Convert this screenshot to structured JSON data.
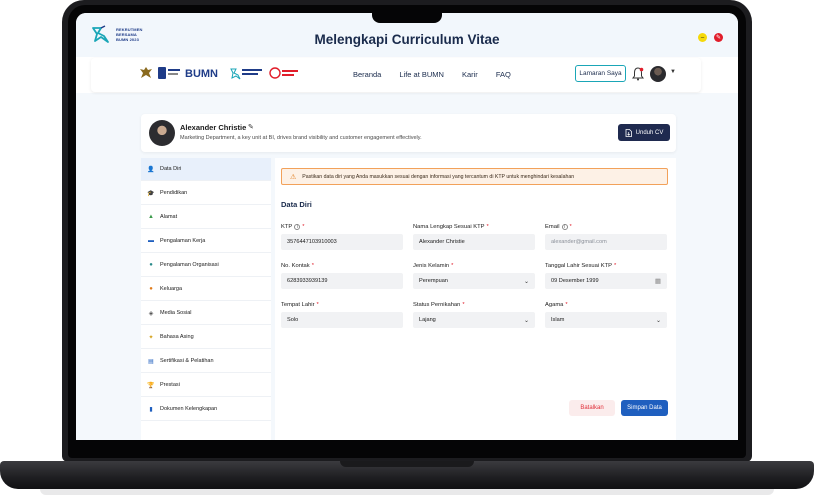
{
  "header": {
    "brand_text": [
      "REKRUTMEN",
      "BERSAMA",
      "BUMN 2023"
    ],
    "page_title": "Melengkapi Curriculum Vitae"
  },
  "navbar": {
    "links": [
      "Beranda",
      "Life at BUMN",
      "Karir",
      "FAQ"
    ],
    "lamaran_button": "Lamaran Saya"
  },
  "profile": {
    "name": "Alexander Christie",
    "description": "Marketing Department, a key unit at BI, drives brand visibility and customer engagement effectively.",
    "download_button": "Unduh CV"
  },
  "sidebar": {
    "items": [
      {
        "label": "Data Diri",
        "icon": "person-icon",
        "active": true
      },
      {
        "label": "Pendidikan",
        "icon": "graduation-cap-icon"
      },
      {
        "label": "Alamat",
        "icon": "map-icon"
      },
      {
        "label": "Pengalaman Kerja",
        "icon": "briefcase-icon"
      },
      {
        "label": "Pengalaman Organisasi",
        "icon": "organization-icon"
      },
      {
        "label": "Keluarga",
        "icon": "family-icon"
      },
      {
        "label": "Media Sosial",
        "icon": "social-icon"
      },
      {
        "label": "Bahasa Asing",
        "icon": "language-icon"
      },
      {
        "label": "Sertifikasi & Pelatihan",
        "icon": "certificate-icon"
      },
      {
        "label": "Prestasi",
        "icon": "trophy-icon"
      },
      {
        "label": "Dokumen Kelengkapan",
        "icon": "document-icon"
      }
    ]
  },
  "form": {
    "alert": "Pastikan data diri yang Anda masukkan sesuai dengan informasi yang tercantum di KTP untuk menghindari kesalahan",
    "section_title": "Data Diri",
    "fields": {
      "ktp": {
        "label": "KTP",
        "value": "3576447103910003"
      },
      "nama": {
        "label": "Nama Lengkap Sesuai KTP",
        "value": "Alexander Christie"
      },
      "email": {
        "label": "Email",
        "placeholder": "alexander@gmail.com"
      },
      "kontak": {
        "label": "No. Kontak",
        "value": "6283933939139"
      },
      "jenis_kelamin": {
        "label": "Jenis Kelamin",
        "value": "Perempuan"
      },
      "tanggal_lahir": {
        "label": "Tanggal Lahir Sesuai KTP",
        "value": "09 Desember 1999"
      },
      "tempat_lahir": {
        "label": "Tempat Lahir",
        "value": "Solo"
      },
      "status": {
        "label": "Status Pernikahan",
        "value": "Lajang"
      },
      "agama": {
        "label": "Agama",
        "value": "Islam"
      }
    },
    "cancel_button": "Batalkan",
    "save_button": "Simpan Data"
  },
  "colors": {
    "primary": "#1f5fbf",
    "navy": "#1f2a4f",
    "danger": "#e11d2a",
    "warning": "#f2a15a"
  }
}
